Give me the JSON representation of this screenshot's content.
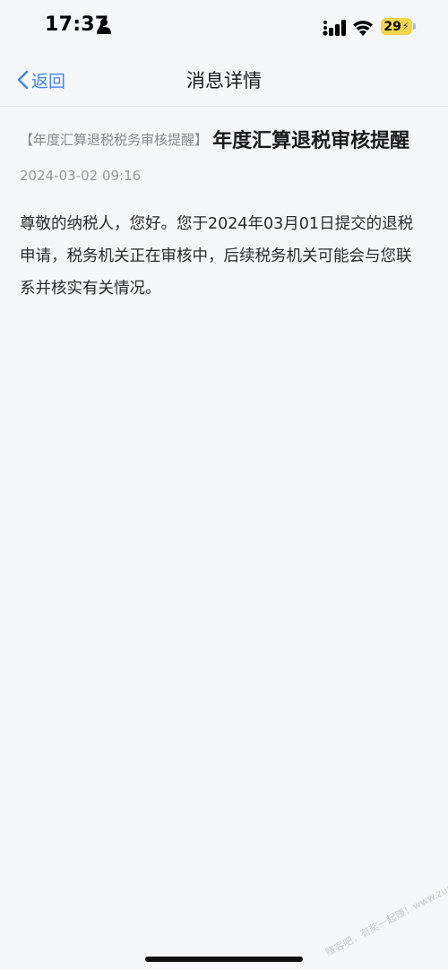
{
  "status_bar": {
    "time": "17:37",
    "battery": "29",
    "icons": [
      "person-icon",
      "cellular-signal-icon",
      "wifi-icon",
      "battery-icon"
    ]
  },
  "nav": {
    "back_label": "返回",
    "title": "消息详情"
  },
  "message": {
    "tag": "【年度汇算退税税务审核提醒】",
    "title": "年度汇算退税审核提醒",
    "timestamp": "2024-03-02 09:16",
    "body": "尊敬的纳税人，您好。您于2024年03月01日提交的退税申请，税务机关正在审核中，后续税务机关可能会与您联系并核实有关情况。"
  },
  "watermark": "赚客吧，有奖一起赚！www.zuanke8.com",
  "colors": {
    "accent": "#3d86f4",
    "background": "#f6f7f9",
    "battery": "#f2d64b"
  }
}
